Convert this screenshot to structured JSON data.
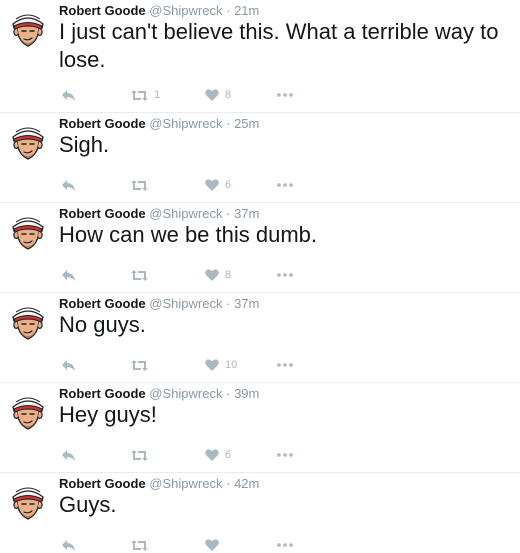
{
  "colors": {
    "text": "#14171a",
    "meta": "#8899a6",
    "action_icon": "#aab8c2",
    "divider": "#e6ecf0"
  },
  "icons": {
    "reply": "reply-icon",
    "retweet": "retweet-icon",
    "like": "heart-icon",
    "more": "more-dots-icon"
  },
  "tweets": [
    {
      "name": "Robert Goode",
      "handle": "@Shipwreck",
      "sep": "·",
      "time": "21m",
      "text": "I just can't believe this. What a terrible way to lose.",
      "retweets": "1",
      "likes": "8"
    },
    {
      "name": "Robert Goode",
      "handle": "@Shipwreck",
      "sep": "·",
      "time": "25m",
      "text": "Sigh.",
      "retweets": "",
      "likes": "6"
    },
    {
      "name": "Robert Goode",
      "handle": "@Shipwreck",
      "sep": "·",
      "time": "37m",
      "text": "How can we be this dumb.",
      "retweets": "",
      "likes": "8"
    },
    {
      "name": "Robert Goode",
      "handle": "@Shipwreck",
      "sep": "·",
      "time": "37m",
      "text": "No guys.",
      "retweets": "",
      "likes": "10"
    },
    {
      "name": "Robert Goode",
      "handle": "@Shipwreck",
      "sep": "·",
      "time": "39m",
      "text": "Hey guys!",
      "retweets": "",
      "likes": "6"
    },
    {
      "name": "Robert Goode",
      "handle": "@Shipwreck",
      "sep": "·",
      "time": "42m",
      "text": "Guys.",
      "retweets": "",
      "likes": ""
    }
  ]
}
